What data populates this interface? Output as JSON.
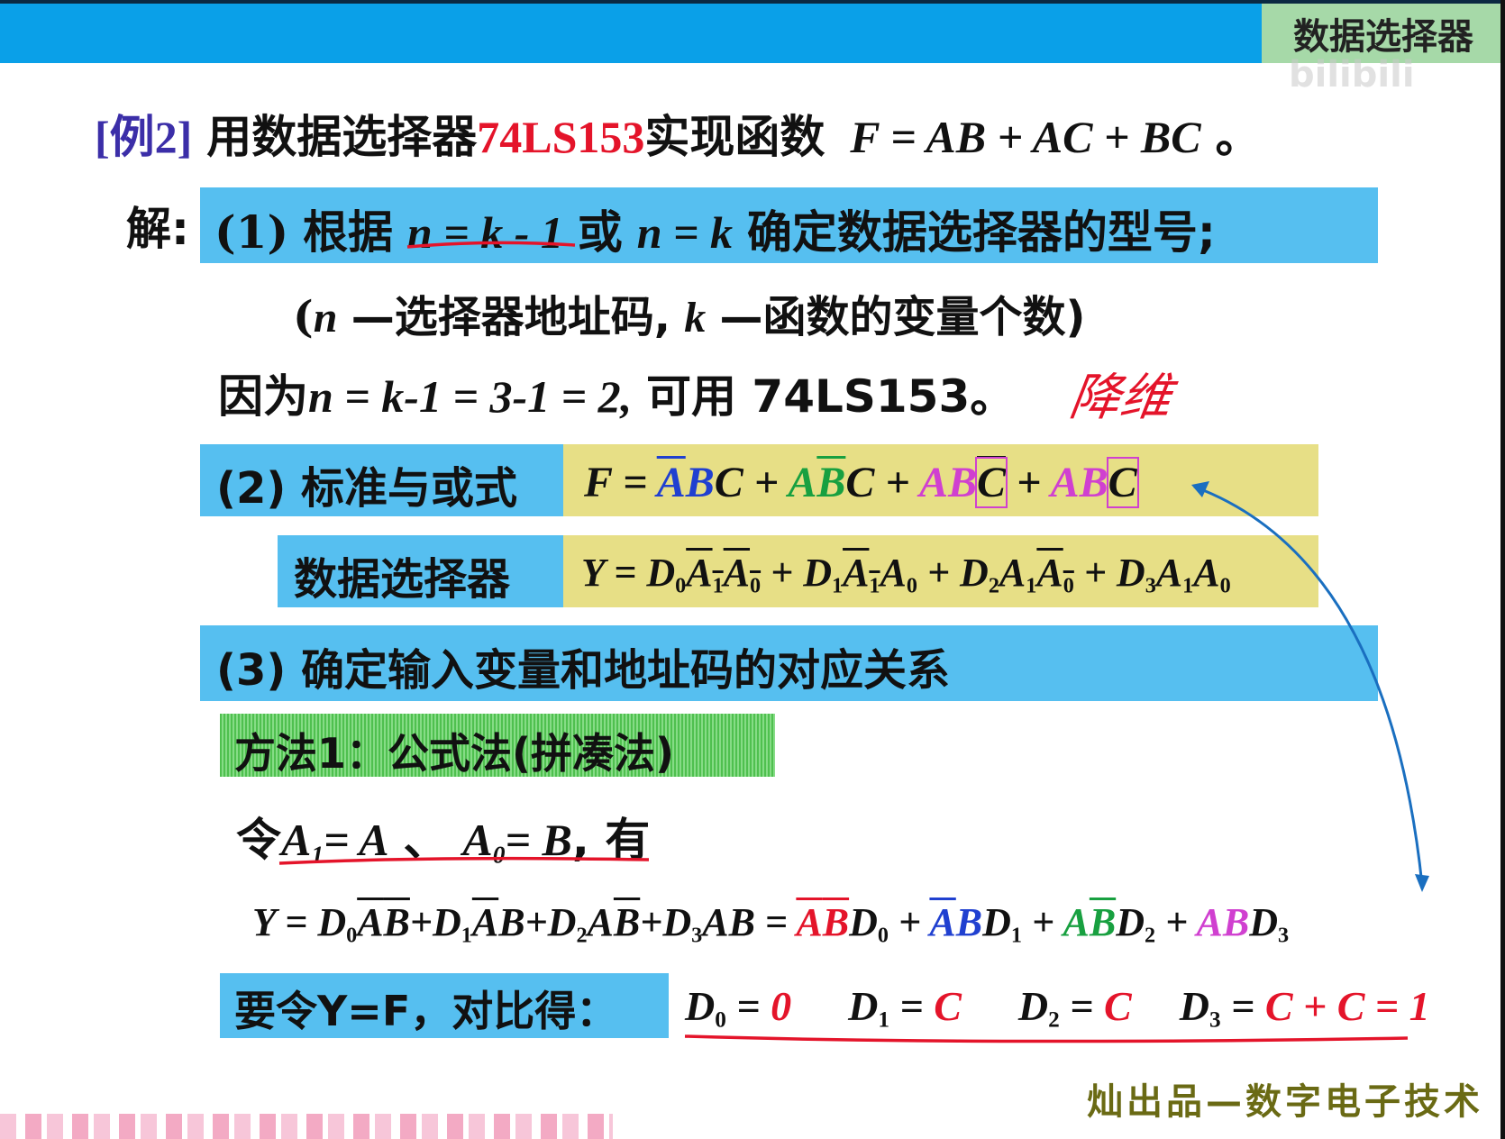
{
  "header": {
    "section_title": "数据选择器",
    "watermark_text": "bilibili"
  },
  "example": {
    "label": "[例2]",
    "text_a": "用数据选择器",
    "chip": "74LS153",
    "text_b": "实现函数",
    "formula": "F = AB + AC + BC",
    "period": "。"
  },
  "solution": {
    "label": "解:",
    "step1": {
      "num": "(1)",
      "text_a": "根据",
      "eq1": "n = k - 1",
      "or": "或",
      "eq2": "n = k",
      "text_b": "确定数据选择器的型号;"
    },
    "note": {
      "open": "(",
      "n": "n",
      "text_a": "—选择器地址码,",
      "k": "k",
      "text_b": "—函数的变量个数)"
    },
    "because": {
      "text_a": "因为",
      "eq": "n = k-1 = 3-1 = 2,",
      "text_b": "可用 74LS153。",
      "handwritten": "降维"
    },
    "step2": {
      "label": "(2) 标准与或式",
      "F": "F =",
      "t1": [
        "A",
        "B",
        "C"
      ],
      "t2": [
        "A",
        "B",
        "C"
      ],
      "t3": [
        "A",
        "B",
        "C"
      ],
      "t4": [
        "A",
        "B",
        "C"
      ],
      "plus": "+"
    },
    "mux": {
      "label": "数据选择器",
      "Y": "Y =",
      "D": "D",
      "A": "A",
      "subs": [
        "0",
        "1",
        "2",
        "3"
      ]
    },
    "step3": {
      "label": "(3) 确定输入变量和地址码的对应关系"
    },
    "method1": {
      "label": "方法1：公式法(拼凑法)"
    },
    "let": {
      "text_a": "令",
      "eq1": "A",
      "eq1_sub": "1",
      "eq1_rhs": "= A",
      "sep": "、",
      "eq2": "A",
      "eq2_sub": "0",
      "eq2_rhs": "= B",
      "text_b": ", 有"
    },
    "yexp": {
      "lead": "Y = D",
      "eq": "=",
      "A": "A",
      "B": "B",
      "D": "D"
    },
    "result": {
      "label": "要令Y=F，对比得：",
      "d0": "0",
      "d1": "C",
      "d2": "C",
      "d3": "C + C = 1"
    }
  },
  "footer": {
    "credit": "灿出品—数字电子技术"
  },
  "colors": {
    "topbar": "#0aa0e8",
    "band_blue": "#56bff0",
    "band_yellow": "#e7df86",
    "band_green": "#4fc04f",
    "red": "#e4142a",
    "blue": "#2040d0",
    "green": "#18a040",
    "magenta": "#d040d0",
    "arrow": "#1a6fc0"
  }
}
